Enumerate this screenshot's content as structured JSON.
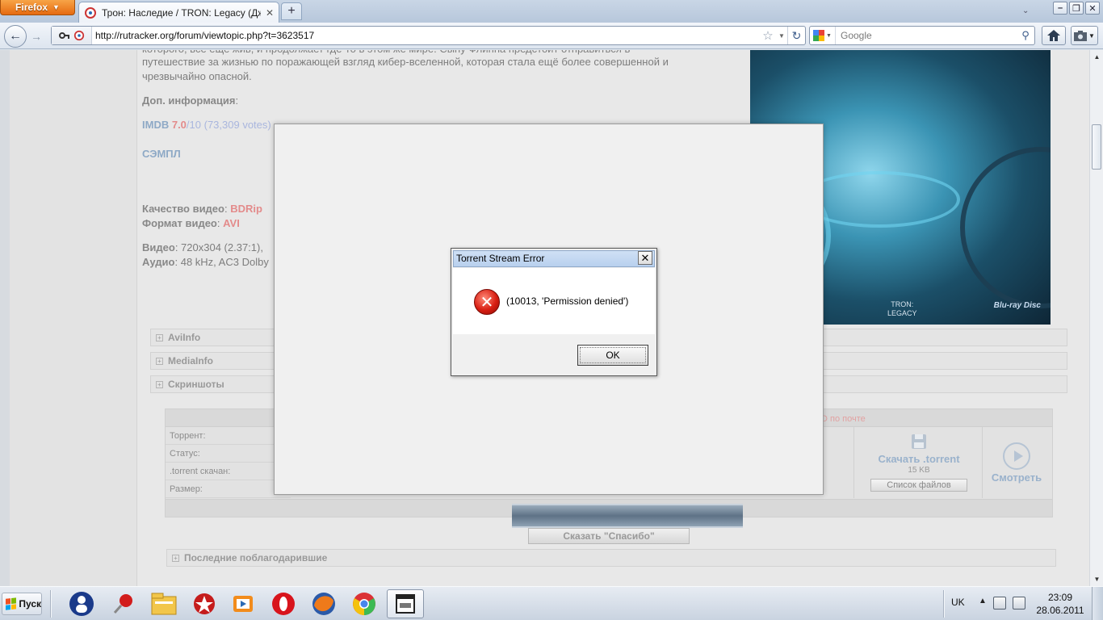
{
  "browser": {
    "menu_button": "Firefox",
    "tab_title": "Трон: Наследие / TRON: Legacy (Джоз...",
    "url": "http://rutracker.org/forum/viewtopic.php?t=3623517",
    "search_placeholder": "Google"
  },
  "page": {
    "desc_line1": "которого, все еще жив, и продолжает где-то в этом же мире. Сыну Флинна предстоит отправиться в",
    "desc_line2": "путешествие за жизнью по поражающей взгляд кибер-вселенной, которая стала ещё более совершенной и",
    "desc_line3": "чрезвычайно опасной.",
    "dop_info_label": "Доп. информация",
    "imdb_label": "IMDB",
    "imdb_rating": "7.0",
    "imdb_suffix": "/10",
    "imdb_votes": "(73,309 votes)",
    "sample_link": "СЭМПЛ",
    "video_quality_label": "Качество видео",
    "video_quality_value": "BDRip",
    "video_format_label": "Формат видео",
    "video_format_value": "AVI",
    "video_label": "Видео",
    "video_value": "720x304 (2.37:1),",
    "audio_label": "Аудио",
    "audio_value": "48 kHz, AC3 Dolby",
    "poster_title_1": "TRON:",
    "poster_title_2": "LEGACY",
    "poster_bluray": "Blu-ray Disc",
    "spoilers": [
      "AviInfo",
      "MediaInfo",
      "Скриншоты"
    ],
    "torrent_rows": [
      "Торрент:",
      "Статус:",
      ".torrent скачан:",
      "Размер:"
    ],
    "mail_link": "D по почте",
    "download_label": "Скачать .torrent",
    "download_size": "15 KB",
    "files_button": "Список файлов",
    "watch_label": "Смотреть",
    "thanks_button": "Сказать \"Спасибо\"",
    "last_thanked": "Последние поблагодарившие"
  },
  "dialog": {
    "title": "Torrent Stream Error",
    "message": "(10013, 'Permission denied')",
    "ok_label": "OK"
  },
  "taskbar": {
    "start_label": "Пуск",
    "language": "UK",
    "time": "23:09",
    "date": "28.06.2011"
  },
  "colors": {
    "ff_orange": "#e66a10",
    "error_red": "#d81e12",
    "link_red": "#e38b8b",
    "link_blue": "#8ea9c6"
  }
}
